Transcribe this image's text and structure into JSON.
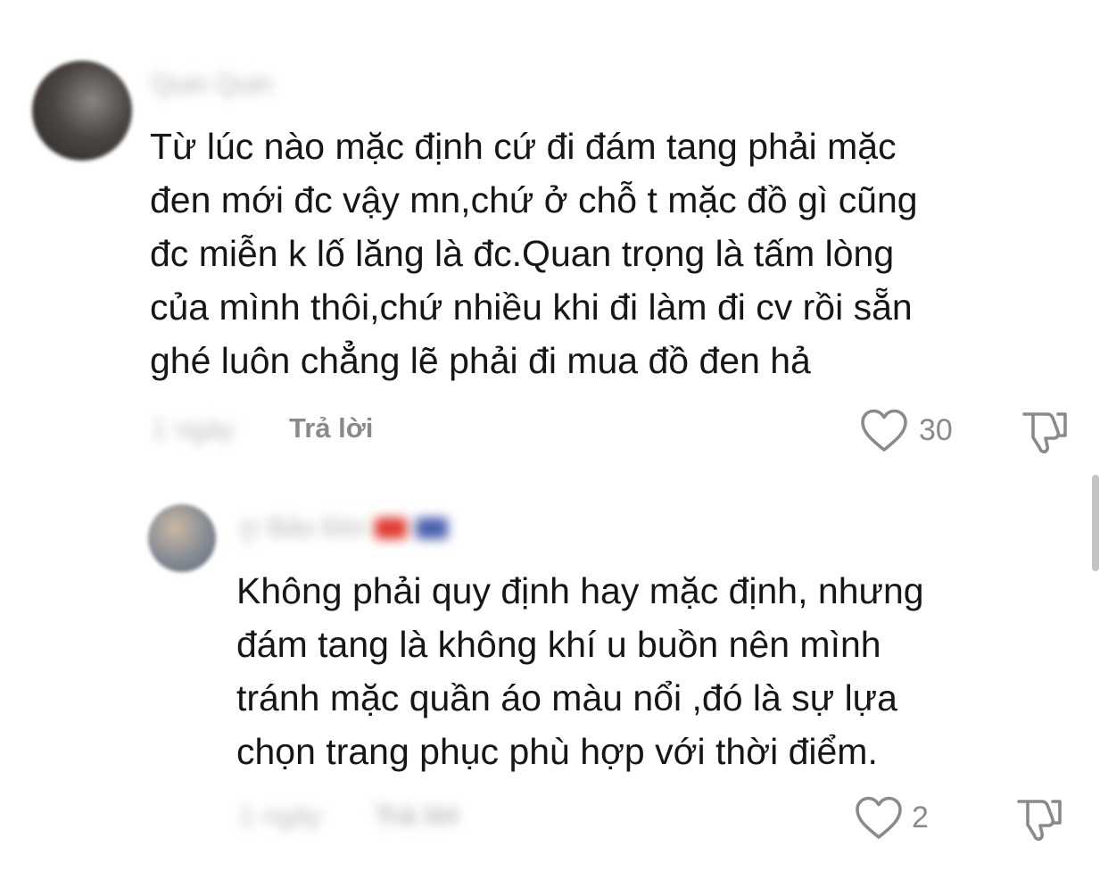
{
  "comments": [
    {
      "username": "Quin Quin",
      "text": "Từ lúc nào mặc định cứ đi đám tang phải mặc\nđen mới đc vậy mn,chứ ở chỗ t mặc đồ gì cũng\nđc miễn k lố lăng là đc.Quan trọng là tấm lòng\ncủa mình thôi,chứ nhiều khi đi làm đi cv rồi sẵn\nghé luôn chẳng lẽ phải đi mua đồ đen hả",
      "time": "1 ngày",
      "reply_label": "Trả lời",
      "like_count": "30"
    },
    {
      "username": "ღ Bảo Đời",
      "text": "Không phải quy định hay mặc định, nhưng\nđám tang là không khí u buồn nên mình\ntránh mặc quần áo màu nổi ,đó là sự lựa\nchọn trang phục phù hợp với thời điểm.",
      "time": "1 ngày",
      "reply_label": "Trả lời",
      "like_count": "2"
    }
  ],
  "icons": {
    "like": "heart-outline-icon",
    "dislike": "thumbs-down-outline-icon"
  },
  "colors": {
    "text": "#161616",
    "muted": "#8a8a8a",
    "blurred": "#bdbdbd",
    "scrollbar": "#c4c4c4"
  }
}
